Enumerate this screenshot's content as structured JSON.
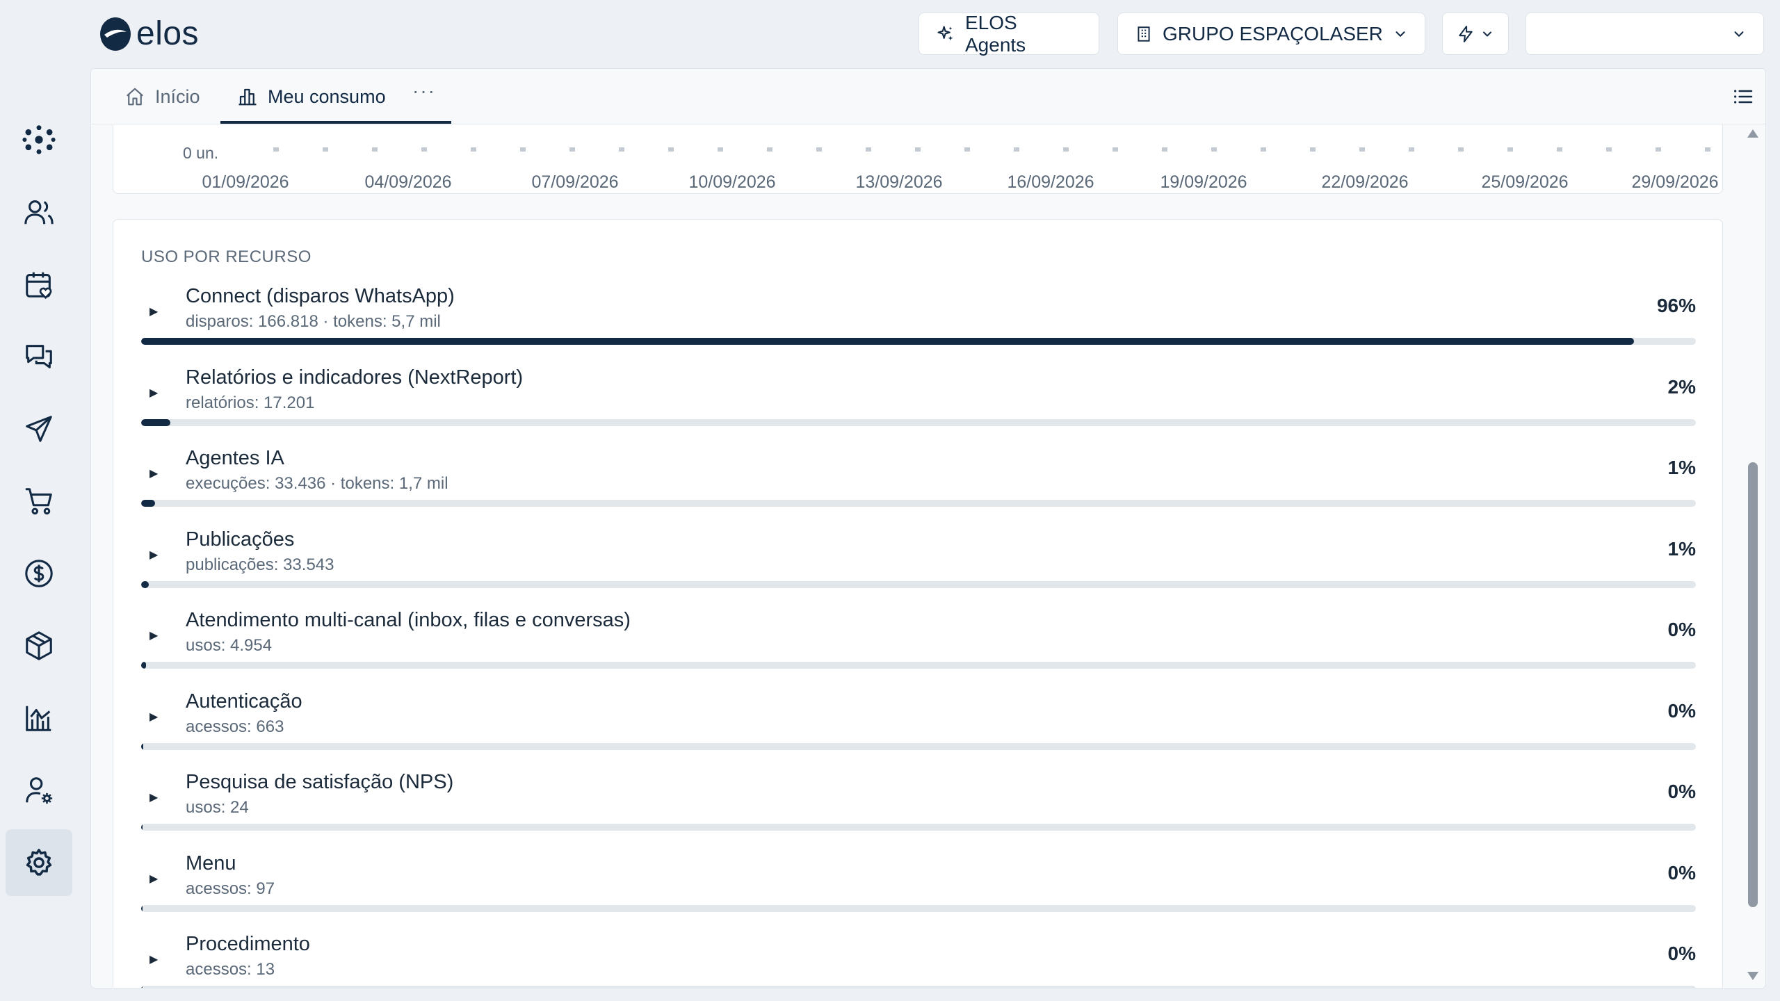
{
  "header": {
    "logo_text": "elos",
    "agents_label": "ELOS Agents",
    "group_label": "GRUPO ESPAÇOLASER",
    "user_label": ""
  },
  "tabs": [
    {
      "label": "Início",
      "icon": "home-icon",
      "active": false
    },
    {
      "label": "Meu consumo",
      "icon": "bar-chart-icon",
      "active": true
    }
  ],
  "tab_more": "···",
  "sidebar": {
    "items": [
      {
        "icon": "network-icon"
      },
      {
        "icon": "users-icon"
      },
      {
        "icon": "calendar-heart-icon"
      },
      {
        "icon": "chat-icon"
      },
      {
        "icon": "send-icon"
      },
      {
        "icon": "cart-icon"
      },
      {
        "icon": "dollar-icon"
      },
      {
        "icon": "box-icon"
      },
      {
        "icon": "chart-icon"
      },
      {
        "icon": "user-settings-icon"
      },
      {
        "icon": "gear-icon",
        "active": true
      }
    ]
  },
  "chart": {
    "zero_label": "0 un.",
    "x_ticks": [
      "01/09/2026",
      "04/09/2026",
      "07/09/2026",
      "10/09/2026",
      "13/09/2026",
      "16/09/2026",
      "19/09/2026",
      "22/09/2026",
      "25/09/2026",
      "29/09/2026"
    ]
  },
  "usage": {
    "title": "USO POR RECURSO",
    "resources": [
      {
        "name": "Connect (disparos WhatsApp)",
        "sub": "disparos: 166.818 · tokens: 5,7 mil",
        "pct_label": "96%",
        "fill": 0.96
      },
      {
        "name": "Relatórios e indicadores (NextReport)",
        "sub": "relatórios: 17.201",
        "pct_label": "2%",
        "fill": 0.019
      },
      {
        "name": "Agentes IA",
        "sub": "execuções: 33.436 · tokens: 1,7 mil",
        "pct_label": "1%",
        "fill": 0.009
      },
      {
        "name": "Publicações",
        "sub": "publicações: 33.543",
        "pct_label": "1%",
        "fill": 0.005
      },
      {
        "name": "Atendimento multi-canal (inbox, filas e conversas)",
        "sub": "usos: 4.954",
        "pct_label": "0%",
        "fill": 0.003
      },
      {
        "name": "Autenticação",
        "sub": "acessos: 663",
        "pct_label": "0%",
        "fill": 0.0015
      },
      {
        "name": "Pesquisa de satisfação (NPS)",
        "sub": "usos: 24",
        "pct_label": "0%",
        "fill": 0.001
      },
      {
        "name": "Menu",
        "sub": "acessos: 97",
        "pct_label": "0%",
        "fill": 0.001
      },
      {
        "name": "Procedimento",
        "sub": "acessos: 13",
        "pct_label": "0%",
        "fill": 0.001
      }
    ]
  },
  "colors": {
    "accent": "#132a45",
    "track": "#e2e7ec",
    "background": "#edf1f5"
  }
}
